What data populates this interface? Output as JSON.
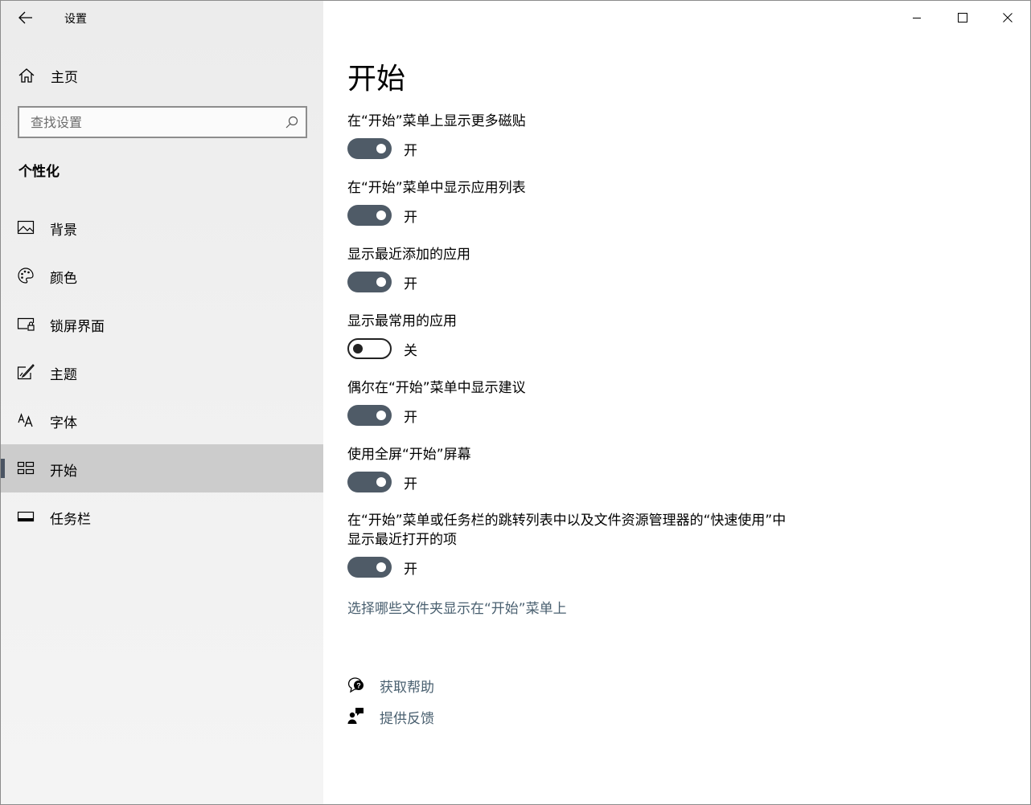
{
  "window": {
    "app_title": "设置",
    "back_icon": "back-arrow-icon",
    "caption_buttons": [
      "minimize-icon",
      "maximize-icon",
      "close-icon"
    ]
  },
  "sidebar": {
    "home": {
      "label": "主页",
      "icon": "home-icon"
    },
    "search": {
      "placeholder": "查找设置",
      "icon": "search-icon"
    },
    "section_title": "个性化",
    "items": [
      {
        "label": "背景",
        "icon": "picture-icon",
        "selected": false
      },
      {
        "label": "颜色",
        "icon": "palette-icon",
        "selected": false
      },
      {
        "label": "锁屏界面",
        "icon": "lock-screen-icon",
        "selected": false
      },
      {
        "label": "主题",
        "icon": "theme-brush-icon",
        "selected": false
      },
      {
        "label": "字体",
        "icon": "font-icon",
        "selected": false
      },
      {
        "label": "开始",
        "icon": "start-tiles-icon",
        "selected": true
      },
      {
        "label": "任务栏",
        "icon": "taskbar-icon",
        "selected": false
      }
    ],
    "accent_color": "#4b5563",
    "selected_bg": "#cccccc"
  },
  "main": {
    "title": "开始",
    "settings": [
      {
        "label": "在“开始”菜单上显示更多磁贴",
        "state": "开",
        "on": true
      },
      {
        "label": "在“开始”菜单中显示应用列表",
        "state": "开",
        "on": true
      },
      {
        "label": "显示最近添加的应用",
        "state": "开",
        "on": true
      },
      {
        "label": "显示最常用的应用",
        "state": "关",
        "on": false
      },
      {
        "label": "偶尔在“开始”菜单中显示建议",
        "state": "开",
        "on": true
      },
      {
        "label": "使用全屏“开始”屏幕",
        "state": "开",
        "on": true
      },
      {
        "label": "在“开始”菜单或任务栏的跳转列表中以及文件资源管理器的“快速使用”中\n显示最近打开的项",
        "state": "开",
        "on": true
      }
    ],
    "folders_link": "选择哪些文件夹显示在“开始”菜单上",
    "help": [
      {
        "label": "获取帮助",
        "icon": "help-chat-icon"
      },
      {
        "label": "提供反馈",
        "icon": "feedback-icon"
      }
    ],
    "toggle_on_color": "#4f5b67",
    "link_color": "#4a6070"
  }
}
